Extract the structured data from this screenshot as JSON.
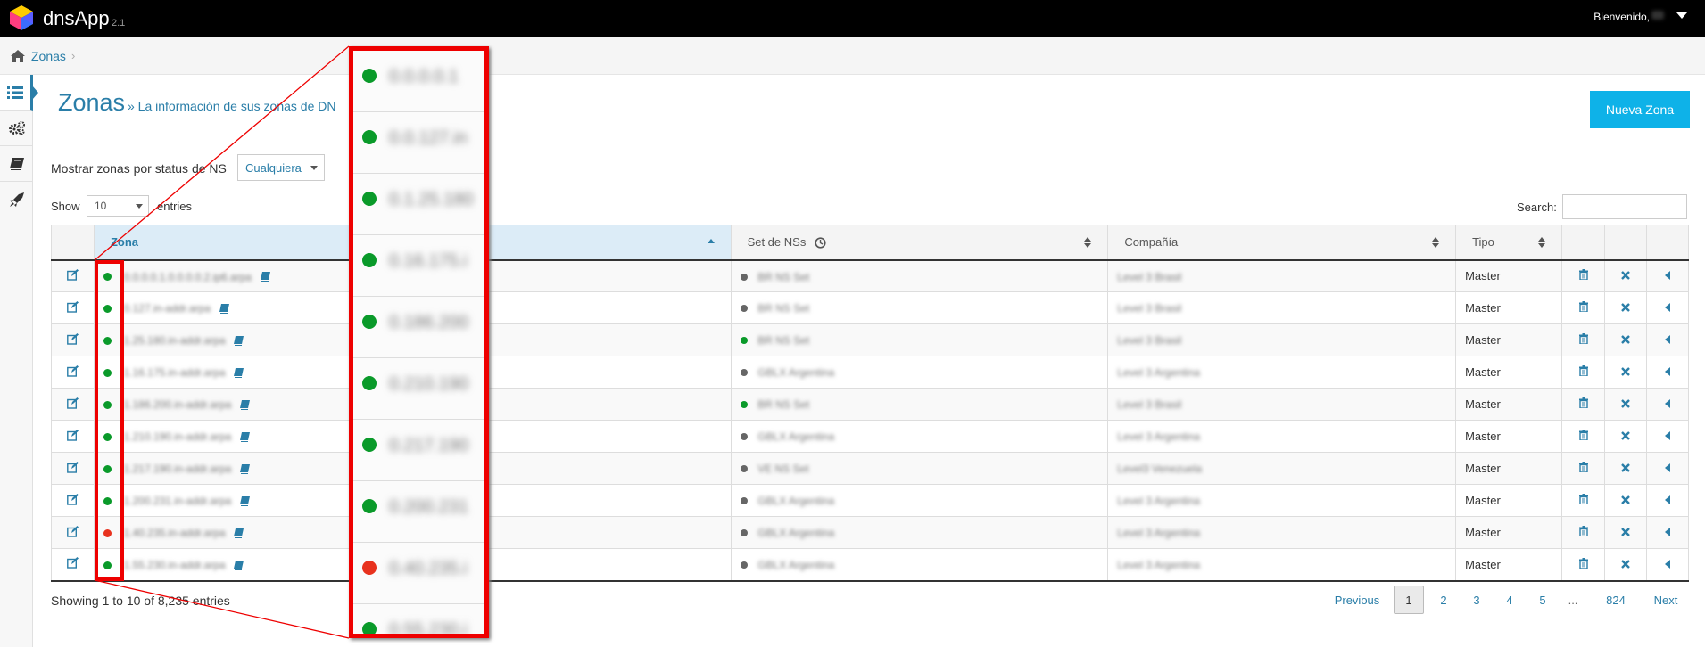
{
  "app": {
    "brand": "dnsApp",
    "version": "2.1",
    "welcome": "Bienvenido,"
  },
  "breadcrumb": {
    "zonas": "Zonas",
    "sep": "›"
  },
  "page": {
    "title": "Zonas",
    "subtitle": "» La información de sus zonas de DN",
    "new_button": "Nueva Zona"
  },
  "filter": {
    "label": "Mostrar zonas por status de NS",
    "selected": "Cualquiera"
  },
  "table_controls": {
    "show_label": "Show",
    "show_value": "10",
    "entries_label": "entries",
    "search_label": "Search:"
  },
  "columns": {
    "zona": "Zona",
    "set_ns": "Set de NSs",
    "compania": "Compañía",
    "tipo": "Tipo"
  },
  "rows": [
    {
      "status": "green",
      "zona": "0.0.0.0.1.0.0.0.0.2.ip6.arpa",
      "ns_status": "grey",
      "set_ns": "BR NS Set",
      "compania": "Level 3 Brasil",
      "tipo": "Master"
    },
    {
      "status": "green",
      "zona": "0.127.in-addr.arpa",
      "ns_status": "grey",
      "set_ns": "BR NS Set",
      "compania": "Level 3 Brasil",
      "tipo": "Master"
    },
    {
      "status": "green",
      "zona": "1.25.180.in-addr.arpa",
      "ns_status": "green",
      "set_ns": "BR NS Set",
      "compania": "Level 3 Brasil",
      "tipo": "Master"
    },
    {
      "status": "green",
      "zona": "1.16.175.in-addr.arpa",
      "ns_status": "grey",
      "set_ns": "GBLX Argentina",
      "compania": "Level 3 Argentina",
      "tipo": "Master"
    },
    {
      "status": "green",
      "zona": "1.186.200.in-addr.arpa",
      "ns_status": "green",
      "set_ns": "BR NS Set",
      "compania": "Level 3 Brasil",
      "tipo": "Master"
    },
    {
      "status": "green",
      "zona": "1.210.190.in-addr.arpa",
      "ns_status": "grey",
      "set_ns": "GBLX Argentina",
      "compania": "Level 3 Argentina",
      "tipo": "Master"
    },
    {
      "status": "green",
      "zona": "1.217.190.in-addr.arpa",
      "ns_status": "grey",
      "set_ns": "VE NS Set",
      "compania": "Level3 Venezuela",
      "tipo": "Master"
    },
    {
      "status": "green",
      "zona": "1.200.231.in-addr.arpa",
      "ns_status": "grey",
      "set_ns": "GBLX Argentina",
      "compania": "Level 3 Argentina",
      "tipo": "Master"
    },
    {
      "status": "red",
      "zona": "1.40.235.in-addr.arpa",
      "ns_status": "grey",
      "set_ns": "GBLX Argentina",
      "compania": "Level 3 Argentina",
      "tipo": "Master"
    },
    {
      "status": "green",
      "zona": "1.55.230.in-addr.arpa",
      "ns_status": "grey",
      "set_ns": "GBLX Argentina",
      "compania": "Level 3 Argentina",
      "tipo": "Master"
    }
  ],
  "footer": {
    "info": "Showing 1 to 10 of 8,235 entries",
    "previous": "Previous",
    "pages": [
      "1",
      "2",
      "3",
      "4",
      "5",
      "...",
      "824"
    ],
    "next": "Next"
  },
  "zoom_rows": [
    {
      "status": "green",
      "text": "0.0.0.0.1"
    },
    {
      "status": "green",
      "text": "0.0.127.in"
    },
    {
      "status": "green",
      "text": "0.1.25.180"
    },
    {
      "status": "green",
      "text": "0.16.175.i"
    },
    {
      "status": "green",
      "text": "0.186.200"
    },
    {
      "status": "green",
      "text": "0.210.190"
    },
    {
      "status": "green",
      "text": "0.217.190"
    },
    {
      "status": "green",
      "text": "0.200.231"
    },
    {
      "status": "red",
      "text": "0.40.235.i"
    },
    {
      "status": "green",
      "text": "0.55.230.i"
    }
  ],
  "colors": {
    "accent": "#2a7ea8",
    "button": "#0eb2e8",
    "ok": "#0a9a2a",
    "error": "#e8321e",
    "highlight": "#ee0000"
  }
}
